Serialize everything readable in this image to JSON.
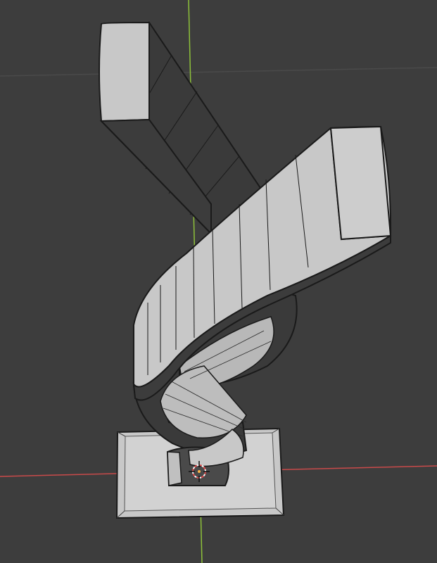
{
  "viewport": {
    "background": "#3d3d3d",
    "grid_line_color": "#4a4a4a",
    "x_axis_color": "#c94a4a",
    "y_axis_color": "#8ec13a",
    "object_color": "#c8c8c8",
    "object_dark_color": "#3a3a3a",
    "edge_color": "#1a1a1a",
    "cursor_color": "#e04a4a"
  },
  "scene": {
    "objects": [
      "base-plate",
      "spiral-strip",
      "upper-beam",
      "lower-beam"
    ],
    "tool": "3d-cursor"
  }
}
